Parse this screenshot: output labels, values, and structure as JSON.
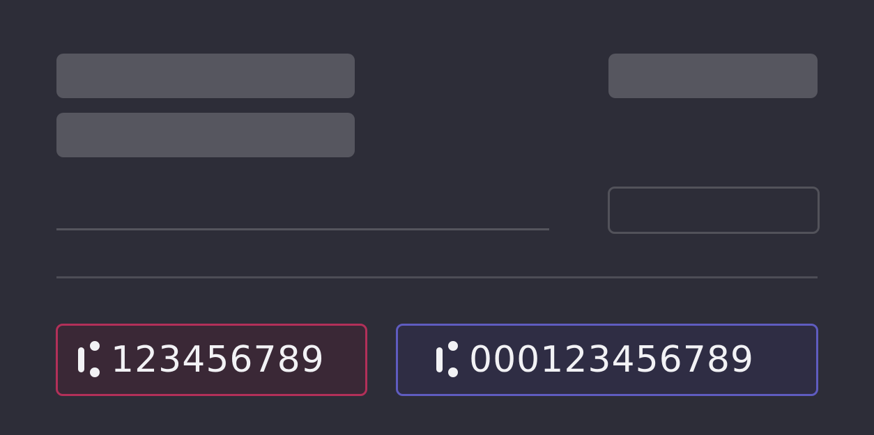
{
  "chips": [
    {
      "value": "123456789",
      "icon": "colon-marker-icon",
      "color": "#b23059"
    },
    {
      "value": "000123456789",
      "icon": "colon-marker-icon",
      "color": "#5f5cc0"
    }
  ],
  "colors": {
    "background": "#2d2d38",
    "skeleton": "#56565f",
    "divider": "#4d4d56"
  }
}
